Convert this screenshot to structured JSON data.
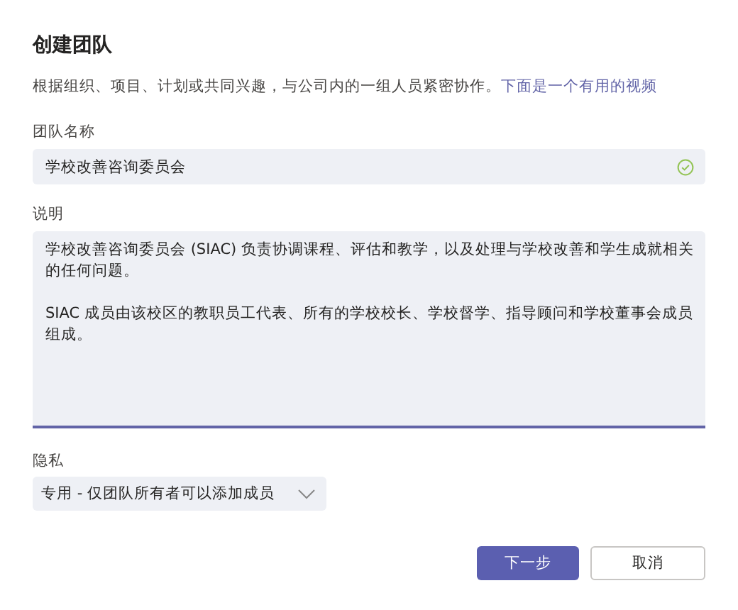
{
  "dialog": {
    "title": "创建团队",
    "description": "根据组织、项目、计划或共同兴趣，与公司内的一组人员紧密协作。",
    "link": "下面是一个有用的视频"
  },
  "name_field": {
    "label": "团队名称",
    "value": "学校改善咨询委员会",
    "valid": true
  },
  "description_field": {
    "label": "说明",
    "value": "学校改善咨询委员会 (SIAC) 负责协调课程、评估和教学，以及处理与学校改善和学生成就相关的任何问题。\n\nSIAC 成员由该校区的教职员工代表、所有的学校校长、学校督学、指导顾问和学校董事会成员组成。",
    "focused": true
  },
  "privacy_field": {
    "label": "隐私",
    "value": "专用 - 仅团队所有者可以添加成员"
  },
  "buttons": [
    {
      "label": "下一步",
      "kind": "primary"
    },
    {
      "label": "取消",
      "kind": "secondary"
    }
  ]
}
